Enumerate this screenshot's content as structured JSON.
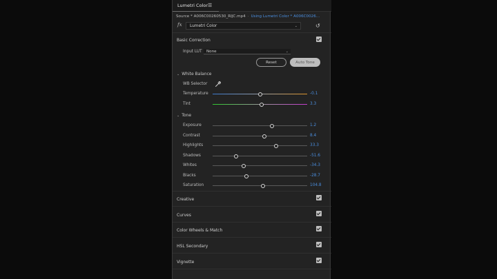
{
  "panel": {
    "title": "Lumetri Color",
    "menu_icon": "hamburger-menu-icon"
  },
  "source": {
    "clip_label": "Source * A006C00260530_RIJC.mp4",
    "separator": "·",
    "active_label": "Using Lumetri Color * A006C0026..."
  },
  "effect": {
    "fx_label": "fx",
    "selected": "Lumetri Color",
    "reset_icon": "reset-icon"
  },
  "basic_correction": {
    "title": "Basic Correction",
    "enabled": true,
    "input_lut_label": "Input LUT",
    "input_lut_value": "None",
    "reset_label": "Reset",
    "auto_tone_label": "Auto Tone",
    "white_balance": {
      "title": "White Balance",
      "wb_selector_label": "WB Selector",
      "eyedropper_icon": "eyedropper-icon",
      "sliders": [
        {
          "label": "Temperature",
          "value": "-0.1",
          "position": 0.5,
          "track": "temperature"
        },
        {
          "label": "Tint",
          "value": "3.3",
          "position": 0.52,
          "track": "tint"
        }
      ]
    },
    "tone": {
      "title": "Tone",
      "sliders": [
        {
          "label": "Exposure",
          "value": "1.2",
          "position": 0.63
        },
        {
          "label": "Contrast",
          "value": "8.4",
          "position": 0.55
        },
        {
          "label": "Highlights",
          "value": "33.3",
          "position": 0.67
        },
        {
          "label": "Shadows",
          "value": "-51.6",
          "position": 0.25
        },
        {
          "label": "Whites",
          "value": "-34.3",
          "position": 0.33
        },
        {
          "label": "Blacks",
          "value": "-28.7",
          "position": 0.36
        },
        {
          "label": "Saturation",
          "value": "104.8",
          "position": 0.53
        }
      ]
    }
  },
  "sections": [
    {
      "title": "Creative",
      "enabled": true
    },
    {
      "title": "Curves",
      "enabled": true
    },
    {
      "title": "Color Wheels & Match",
      "enabled": true
    },
    {
      "title": "HSL Secondary",
      "enabled": true
    },
    {
      "title": "Vignette",
      "enabled": true
    }
  ],
  "colors": {
    "accent": "#4b8fe0",
    "panel_bg": "#232323",
    "background": "#0b0b0b"
  }
}
